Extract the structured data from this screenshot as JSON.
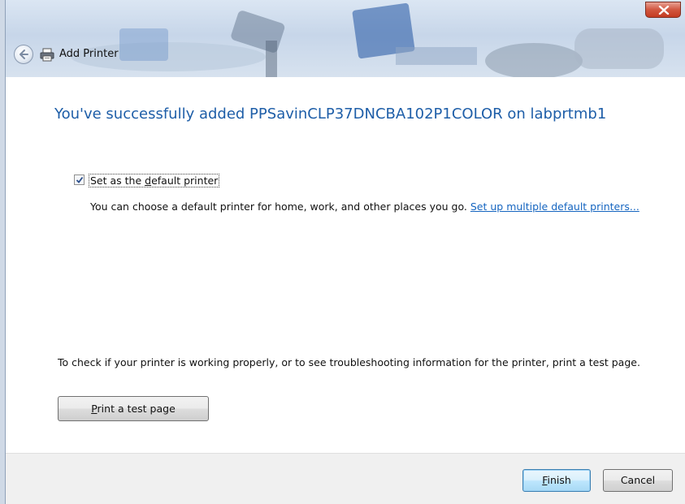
{
  "window": {
    "title": "Add Printer"
  },
  "content": {
    "heading": "You've successfully added PPSavinCLP37DNCBA102P1COLOR on labprtmb1",
    "default_checkbox": {
      "checked": true,
      "label_pre": "Set as the ",
      "label_access": "d",
      "label_post": "efault printer"
    },
    "description_text": "You can choose a default printer for home, work, and other places you go. ",
    "description_link": "Set up multiple default printers...",
    "test_info": "To check if your printer is working properly, or to see troubleshooting information for the printer, print a test page.",
    "test_button": {
      "access": "P",
      "rest": "rint a test page"
    }
  },
  "footer": {
    "finish": {
      "access": "F",
      "rest": "inish"
    },
    "cancel": "Cancel"
  },
  "colors": {
    "heading": "#1e5ea8",
    "link": "#1565c0",
    "close_button": "#c43b22"
  },
  "icons": [
    "back-arrow-icon",
    "printer-icon",
    "close-icon",
    "checkmark-icon"
  ]
}
